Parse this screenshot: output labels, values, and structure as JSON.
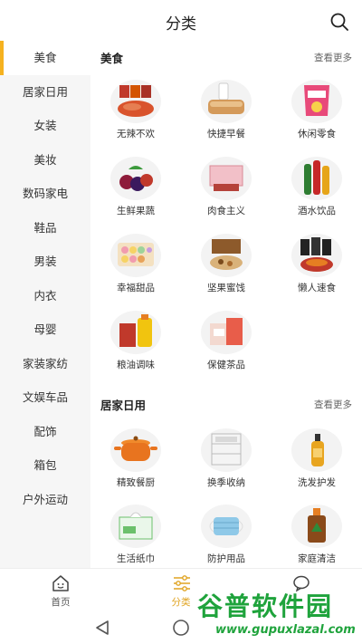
{
  "header": {
    "title": "分类"
  },
  "sidebar": {
    "items": [
      {
        "label": "美食",
        "active": true
      },
      {
        "label": "居家日用"
      },
      {
        "label": "女装"
      },
      {
        "label": "美妆"
      },
      {
        "label": "数码家电"
      },
      {
        "label": "鞋品"
      },
      {
        "label": "男装"
      },
      {
        "label": "内衣"
      },
      {
        "label": "母婴"
      },
      {
        "label": "家装家纺"
      },
      {
        "label": "文娱车品"
      },
      {
        "label": "配饰"
      },
      {
        "label": "箱包"
      },
      {
        "label": "户外运动"
      }
    ]
  },
  "sections": [
    {
      "title": "美食",
      "more": "查看更多",
      "items": [
        {
          "label": "无辣不欢",
          "icon": "spicy-meat-icon"
        },
        {
          "label": "快捷早餐",
          "icon": "bread-milk-icon"
        },
        {
          "label": "休闲零食",
          "icon": "snack-bag-icon"
        },
        {
          "label": "生鲜果蔬",
          "icon": "fruit-icon"
        },
        {
          "label": "肉食主义",
          "icon": "meat-box-icon"
        },
        {
          "label": "酒水饮品",
          "icon": "bottles-icon"
        },
        {
          "label": "幸福甜品",
          "icon": "macaron-icon"
        },
        {
          "label": "坚果蜜饯",
          "icon": "nuts-gift-icon"
        },
        {
          "label": "懒人速食",
          "icon": "instant-food-icon"
        },
        {
          "label": "粮油调味",
          "icon": "oil-rice-icon"
        },
        {
          "label": "保健茶品",
          "icon": "tea-box-icon"
        }
      ]
    },
    {
      "title": "居家日用",
      "more": "查看更多",
      "items": [
        {
          "label": "精致餐厨",
          "icon": "pot-icon"
        },
        {
          "label": "换季收纳",
          "icon": "storage-drawer-icon"
        },
        {
          "label": "洗发护发",
          "icon": "shampoo-icon"
        },
        {
          "label": "生活纸巾",
          "icon": "tissue-icon"
        },
        {
          "label": "防护用品",
          "icon": "mask-icon"
        },
        {
          "label": "家庭清洁",
          "icon": "disinfectant-icon"
        }
      ]
    }
  ],
  "tabbar": {
    "tabs": [
      {
        "label": "首页",
        "icon": "home-icon"
      },
      {
        "label": "分类",
        "icon": "category-icon",
        "active": true
      },
      {
        "label": "",
        "icon": "chat-icon"
      }
    ]
  },
  "colors": {
    "accent": "#f5b220",
    "active_tab": "#e0a422",
    "sidebar_bg": "#f6f6f6"
  },
  "watermark": {
    "text": "谷普软件园",
    "url": "www.gupuxlazal.com"
  }
}
